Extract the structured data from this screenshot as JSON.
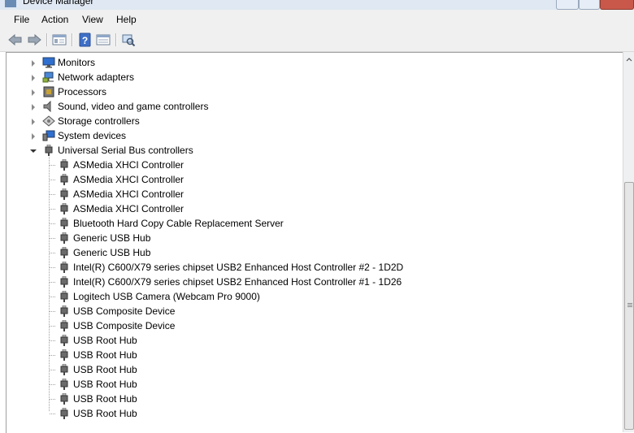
{
  "window": {
    "title": "Device Manager"
  },
  "menu": [
    "File",
    "Action",
    "View",
    "Help"
  ],
  "toolbar": {
    "buttons": [
      "back-icon",
      "forward-icon",
      "show-hide-console-tree-icon",
      "help-icon",
      "properties-icon",
      "scan-hardware-icon"
    ]
  },
  "tree": {
    "categories": [
      {
        "label": "Monitors",
        "expanded": false,
        "icon": "monitor-icon"
      },
      {
        "label": "Network adapters",
        "expanded": false,
        "icon": "network-icon"
      },
      {
        "label": "Processors",
        "expanded": false,
        "icon": "processor-icon"
      },
      {
        "label": "Sound, video and game controllers",
        "expanded": false,
        "icon": "sound-icon"
      },
      {
        "label": "Storage controllers",
        "expanded": false,
        "icon": "storage-icon"
      },
      {
        "label": "System devices",
        "expanded": false,
        "icon": "system-icon"
      },
      {
        "label": "Universal Serial Bus controllers",
        "expanded": true,
        "icon": "usb-icon"
      }
    ],
    "usb_devices": [
      "ASMedia XHCI Controller",
      "ASMedia XHCI Controller",
      "ASMedia XHCI Controller",
      "ASMedia XHCI Controller",
      "Bluetooth Hard Copy Cable Replacement Server",
      "Generic USB Hub",
      "Generic USB Hub",
      "Intel(R) C600/X79 series chipset USB2 Enhanced Host Controller #2 - 1D2D",
      "Intel(R) C600/X79 series chipset USB2 Enhanced Host Controller #1 - 1D26",
      "Logitech USB Camera (Webcam Pro 9000)",
      "USB Composite Device",
      "USB Composite Device",
      "USB Root Hub",
      "USB Root Hub",
      "USB Root Hub",
      "USB Root Hub",
      "USB Root Hub",
      "USB Root Hub"
    ]
  }
}
